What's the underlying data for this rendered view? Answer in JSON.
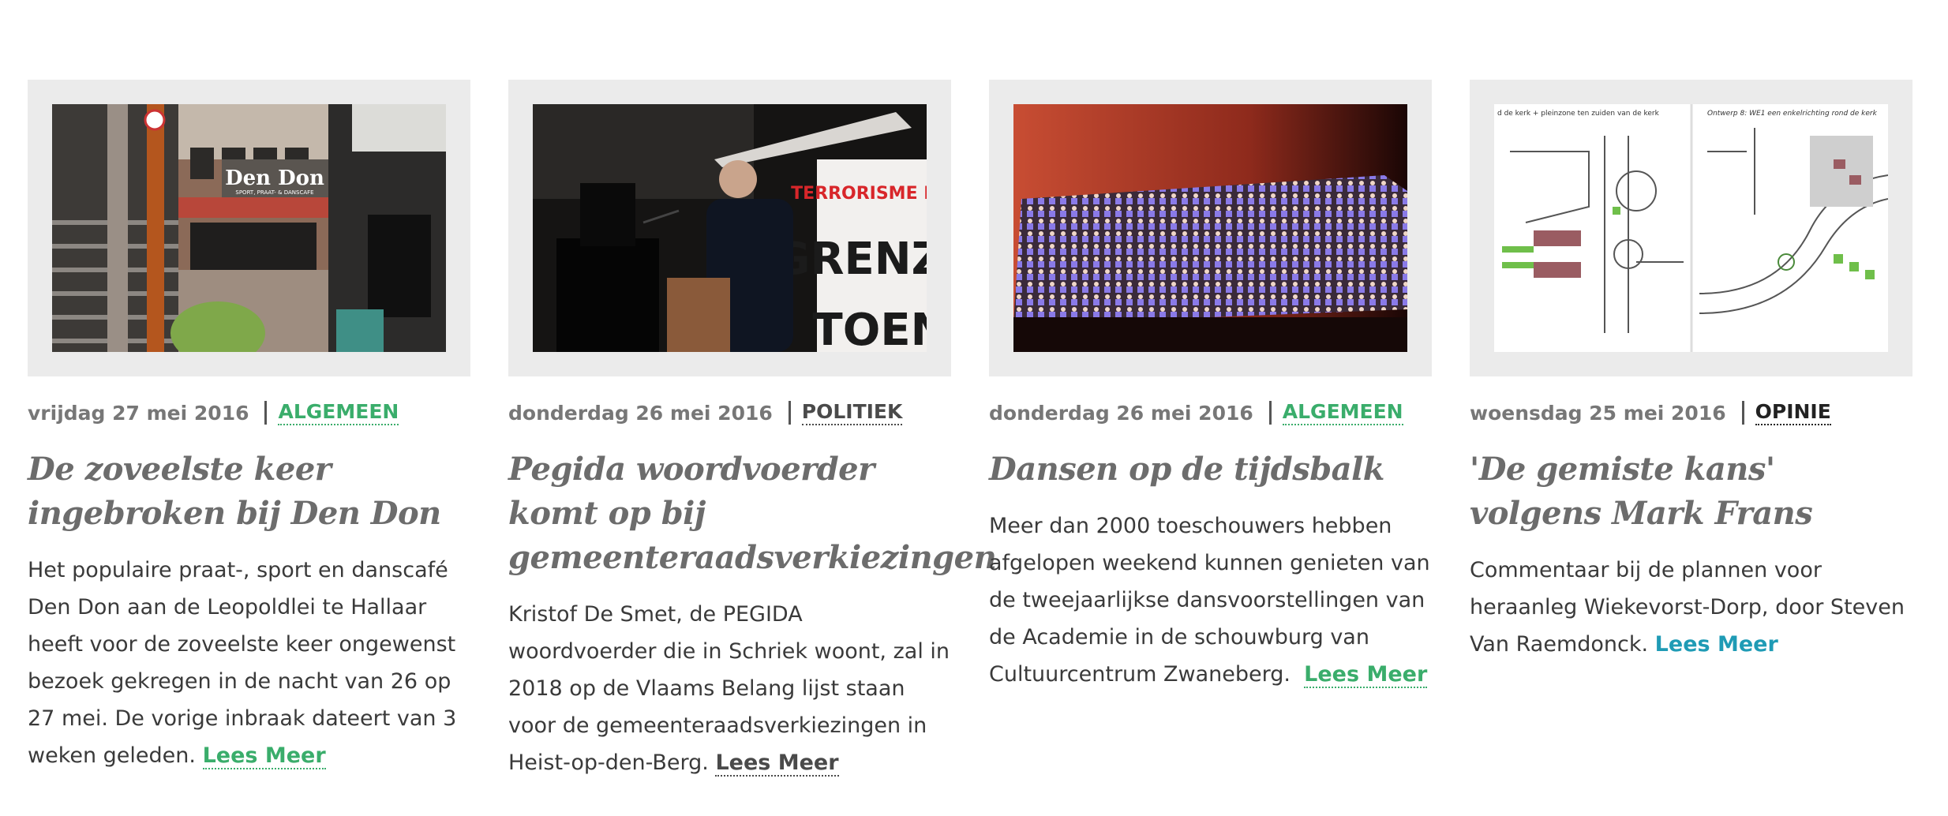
{
  "colors": {
    "green": "#3aad6b",
    "dark": "#4a4a4a",
    "blue": "#1f9bb5"
  },
  "articles": [
    {
      "date": "vrijdag 27 mei 2016",
      "category": "ALGEMEEN",
      "category_color": "#3aad6b",
      "title": "De zoveelste keer ingebroken bij Den Don",
      "excerpt": "Het populaire praat-, sport en danscafé Den Don aan de Leopoldlei te Hallaar heeft voor de zoveelste keer ongewenst bezoek gekregen in de nacht van 26 op 27 mei. De vorige inbraak dateert van 3 weken geleden.",
      "more": "Lees Meer",
      "more_color": "#3aad6b",
      "image_text": "Den Don",
      "image_subtext": "SPORT, PRAAT- & DANSCAFE"
    },
    {
      "date": "donderdag 26 mei 2016",
      "category": "POLITIEK",
      "category_color": "#4a4a4a",
      "title": "Pegida woordvoerder komt op bij gemeenteraadsverkiezingen",
      "excerpt": "Kristof De Smet, de PEGIDA woordvoerder die in Schriek woont, zal in 2018 op de Vlaams Belang lijst staan voor de gemeenteraadsverkiezingen in Heist-op-den-Berg.",
      "more": "Lees Meer",
      "more_color": "#4a4a4a",
      "image_text_1": "TERRORISME HIE",
      "image_text_2": "GRENZE",
      "image_text_3": "TOEN"
    },
    {
      "date": "donderdag 26 mei 2016",
      "category": "ALGEMEEN",
      "category_color": "#3aad6b",
      "title": "Dansen op de tijdsbalk",
      "excerpt": "Meer dan 2000 toeschouwers hebben afgelopen weekend kunnen genieten van de tweejaarlijkse dansvoorstellingen van de Academie in de schouwburg van  Cultuurcentrum Zwaneberg.",
      "more": "Lees Meer",
      "more_color": "#3aad6b"
    },
    {
      "date": "woensdag 25 mei 2016",
      "category": "OPINIE",
      "category_color": "#222222",
      "title": "'De gemiste kans' volgens Mark Frans",
      "excerpt": "Commentaar bij de plannen voor heraanleg Wiekevorst-Dorp, door Steven Van Raemdonck.",
      "more": "Lees Meer",
      "more_color": "#1f9bb5",
      "image_text_1": "d de kerk + pleinzone ten zuiden van de kerk",
      "image_text_2": "Ontwerp 8: WE1 een enkelrichting rond de kerk"
    }
  ]
}
